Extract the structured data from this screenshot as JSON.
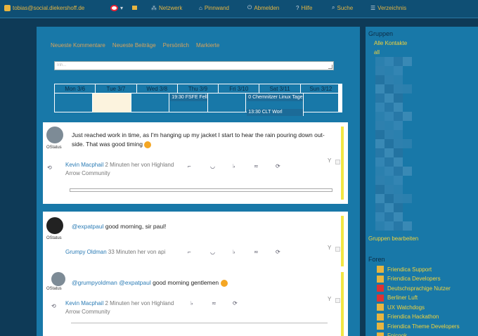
{
  "topbar": {
    "user": "tobias@social.diekershoff.de",
    "nav": [
      {
        "label": "Netzwerk",
        "icon": "network-icon"
      },
      {
        "label": "Pinnwand",
        "icon": "wall-icon"
      },
      {
        "label": "Abmelden",
        "icon": "logout-icon"
      },
      {
        "label": "Hilfe",
        "icon": "help-icon"
      },
      {
        "label": "Suche",
        "icon": "search-icon"
      },
      {
        "label": "Verzeichnis",
        "icon": "directory-icon"
      }
    ]
  },
  "tabs": [
    "Neueste Kommentare",
    "Neueste Beiträge",
    "Persönlich",
    "Markierte"
  ],
  "search": {
    "placeholder": "Inh..."
  },
  "calendar": {
    "days": [
      "Mon 3/6",
      "Tue 3/7",
      "Wed 3/8",
      "Thu 3/9",
      "Fri 3/10",
      "Sat 3/11",
      "Sun 3/12"
    ],
    "events": [
      {
        "day": 3,
        "row": 0,
        "text": "19:30 FSFE Fell"
      },
      {
        "day": 5,
        "row": 0,
        "text": "0 Chemnitzer Linux Tage"
      },
      {
        "day": 5,
        "row": 1,
        "text": "13:30 CLT Worl"
      }
    ]
  },
  "posts": [
    {
      "source": "OStatus",
      "text": "Just reached work in time, as I'm hanging up my jacket I start to hear the rain pouring down out-side. That was good timing",
      "author": "Kevin Macphail",
      "meta": "2 Minuten her von Highland Arrow Community"
    },
    {
      "source": "OStatus",
      "mention": "@expatpaul",
      "text": "good morning, sir paul!",
      "author": "Grumpy Oldman",
      "meta": "33 Minuten her von api",
      "reply": {
        "source": "OStatus",
        "mention1": "@grumpyoldman",
        "mention2": "@expatpaul",
        "text": "good morning gentlemen",
        "author": "Kevin Macphail",
        "meta": "2 Minuten her von Highland Arrow Community"
      }
    }
  ],
  "sidebar": {
    "groups_title": "Gruppen",
    "all_contacts": "Alle Kontakte",
    "all": "all",
    "edit_groups": "Gruppen bearbeiten",
    "forums_title": "Foren",
    "forums": [
      "Friendica Support",
      "Friendica Developers",
      "Deutschsprachige Nutzer",
      "Berliner Luft",
      "UX Watchdogs",
      "Friendica Hackathon",
      "Friendica Theme Developers",
      "Fnicook"
    ]
  },
  "colors": {
    "accent": "#f2d33a",
    "bg": "#0e3a57",
    "panel": "#1878a8"
  }
}
